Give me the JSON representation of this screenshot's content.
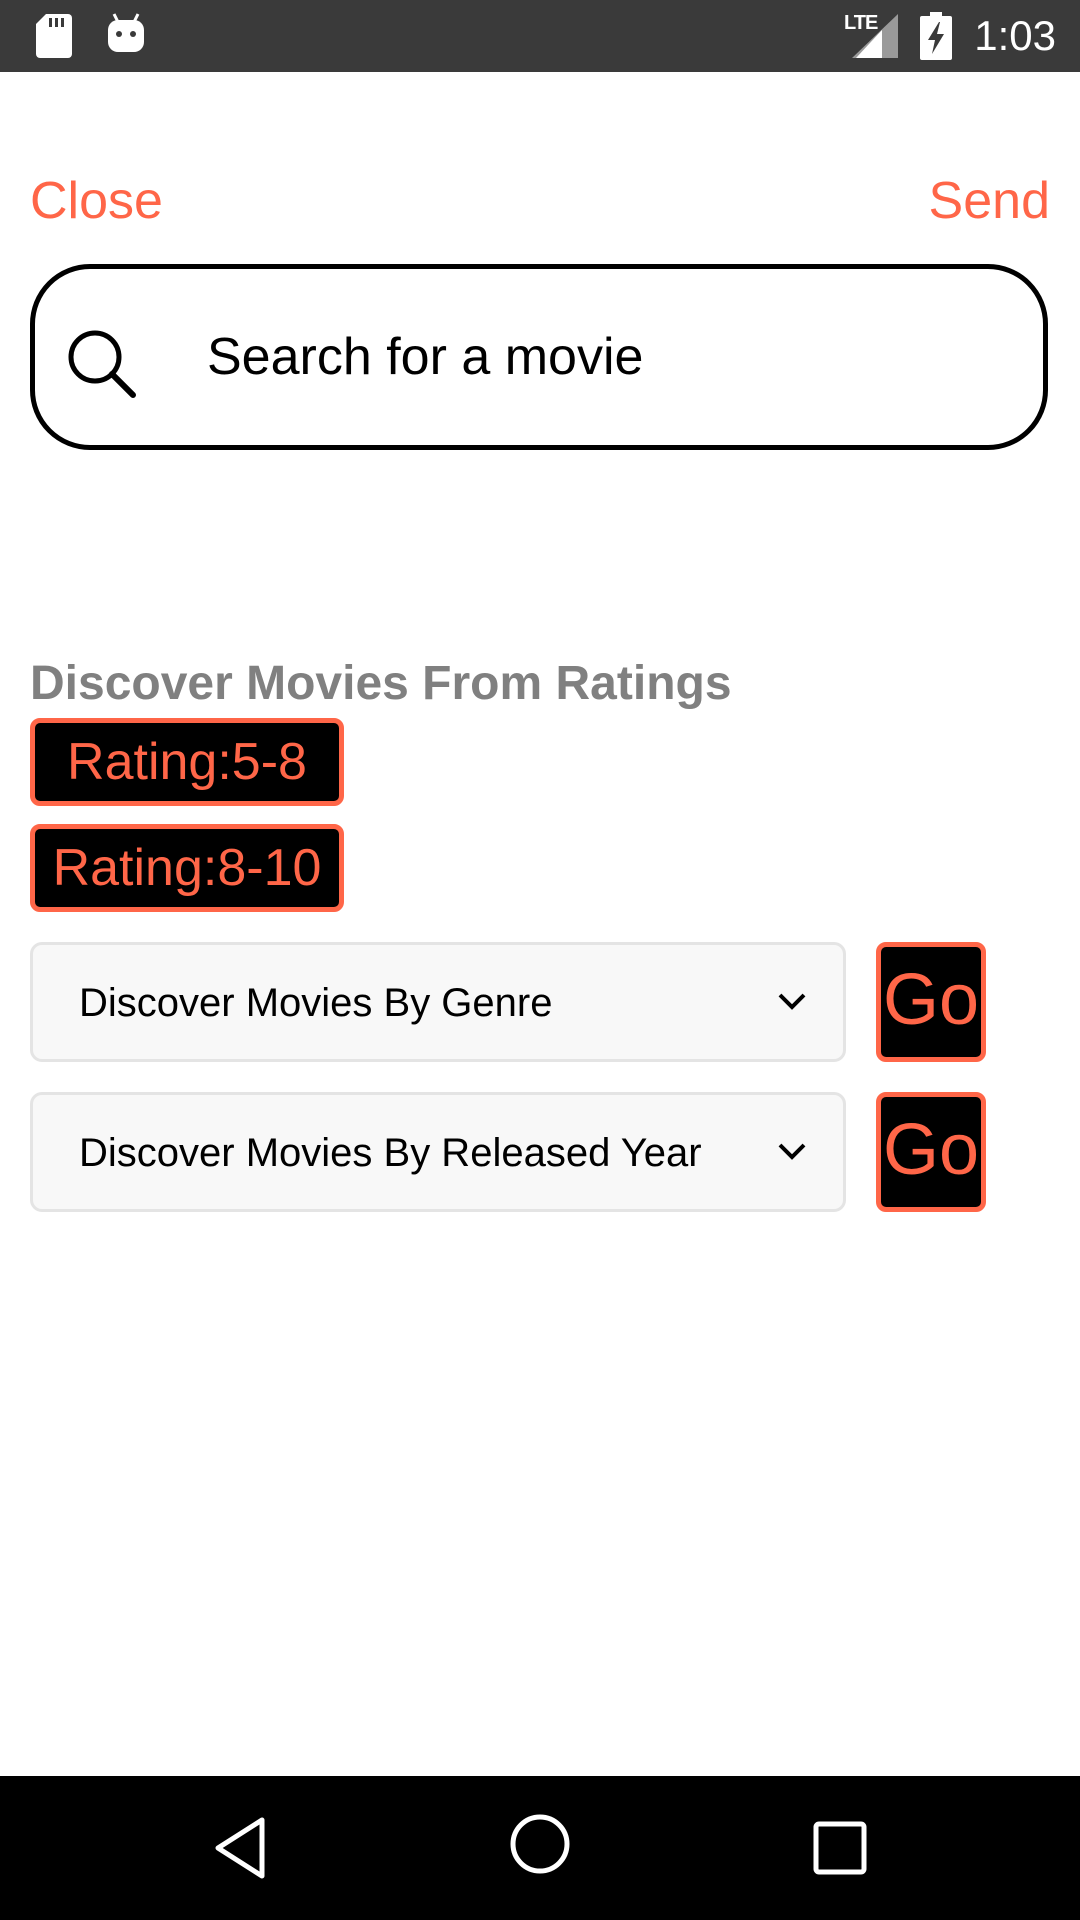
{
  "status_bar": {
    "network": "LTE",
    "time": "1:03",
    "icons": [
      "sdcard-icon",
      "android-icon",
      "signal-icon",
      "battery-charging-icon"
    ]
  },
  "header": {
    "close_label": "Close",
    "send_label": "Send"
  },
  "search": {
    "placeholder": "Search for a movie",
    "value": "",
    "icon": "search-icon"
  },
  "discover": {
    "heading": "Discover Movies From Ratings",
    "rating_buttons": [
      {
        "label": "Rating:5-8"
      },
      {
        "label": "Rating:8-10"
      }
    ],
    "dropdowns": [
      {
        "selected": "Discover Movies By Genre",
        "go_label": "Go"
      },
      {
        "selected": "Discover Movies By Released Year",
        "go_label": "Go"
      }
    ]
  },
  "colors": {
    "accent": "#ff6648",
    "status_bar": "#3a3a3a",
    "heading_gray": "#808080",
    "dropdown_bg": "#f8f8f8",
    "button_bg": "#000000"
  },
  "nav_bar": {
    "icons": [
      "back-icon",
      "home-icon",
      "recents-icon"
    ]
  }
}
